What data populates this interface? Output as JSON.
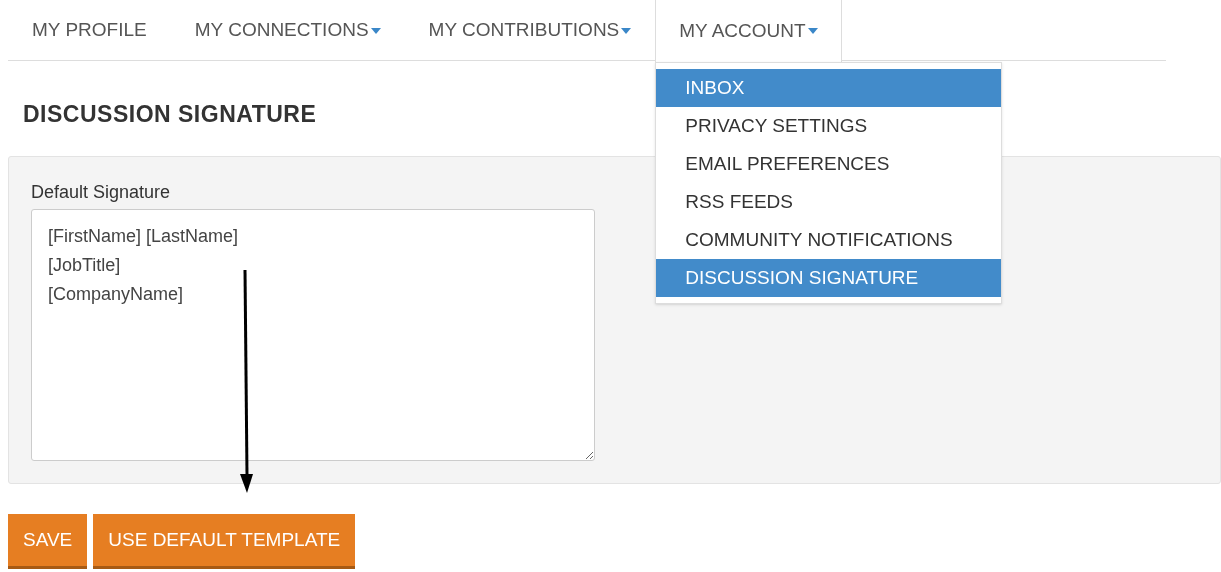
{
  "nav": [
    {
      "label": "MY PROFILE",
      "has_menu": false,
      "open": false
    },
    {
      "label": "MY CONNECTIONS",
      "has_menu": true,
      "open": false
    },
    {
      "label": "MY CONTRIBUTIONS",
      "has_menu": true,
      "open": false
    },
    {
      "label": "MY ACCOUNT",
      "has_menu": true,
      "open": true
    }
  ],
  "dropdown": [
    {
      "label": "INBOX",
      "selected": true
    },
    {
      "label": "PRIVACY SETTINGS",
      "selected": false
    },
    {
      "label": "EMAIL PREFERENCES",
      "selected": false
    },
    {
      "label": "RSS FEEDS",
      "selected": false
    },
    {
      "label": "COMMUNITY NOTIFICATIONS",
      "selected": false
    },
    {
      "label": "DISCUSSION SIGNATURE",
      "selected": true
    }
  ],
  "heading": "DISCUSSION SIGNATURE",
  "signature": {
    "label": "Default Signature",
    "lines": [
      "[FirstName] [LastName]",
      "[JobTitle]",
      "[CompanyName]"
    ]
  },
  "buttons": [
    "SAVE",
    "USE DEFAULT TEMPLATE"
  ]
}
